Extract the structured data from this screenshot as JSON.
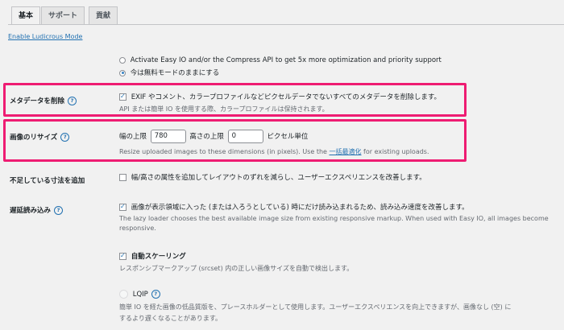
{
  "tabs": [
    "基本",
    "サポート",
    "貢献"
  ],
  "enable_link": "Enable Ludicrous Mode",
  "api_option": {
    "activate_text": "Activate Easy IO and/or the Compress API to get 5x more optimization and priority support",
    "free_text": "今は無料モードのままにする"
  },
  "metadata": {
    "label": "メタデータを削除",
    "checkbox_text": "EXIF やコメント、カラープロファイルなどピクセルデータでないすべてのメタデータを削除します。",
    "desc": "API または簡単 IO を使用する際、カラープロファイルは保持されます。"
  },
  "resize": {
    "label": "画像のリサイズ",
    "width_label": "幅の上限",
    "width_value": "780",
    "height_label": "高さの上限",
    "height_value": "0",
    "unit": "ピクセル単位",
    "desc_before": "Resize uploaded images to these dimensions (in pixels). Use the ",
    "desc_link": "一括最適化",
    "desc_after": " for existing uploads."
  },
  "missing_dims": {
    "label": "不足している寸法を追加",
    "checkbox_text": "幅/高さの属性を追加してレイアウトのずれを減らし、ユーザーエクスペリエンスを改善します。"
  },
  "lazy": {
    "label": "遅延読み込み",
    "checkbox_text": "画像が表示領域に入った (または入ろうとしている) 時にだけ読み込まれるため、読み込み速度を改善します。",
    "desc_line1": "The lazy loader chooses the best available image size from existing responsive markup. When used with Easy IO, all images become",
    "desc_line2": "responsive.",
    "autoscale_label": "自動スケーリング",
    "autoscale_desc": "レスポンシブマークアップ (srcset) 内の正しい画像サイズを自動で検出します。",
    "lqip_label": "LQIP",
    "lqip_desc_line1": "簡単 IO を経た画像の低品質版を、プレースホルダーとして使用します。ユーザーエクスペリエンスを向上できますが、画像なし (空) に",
    "lqip_desc_line2": "するより遅くなることがあります。"
  },
  "colors": {
    "accent": "#2271b1",
    "highlight": "#ee1c72"
  }
}
